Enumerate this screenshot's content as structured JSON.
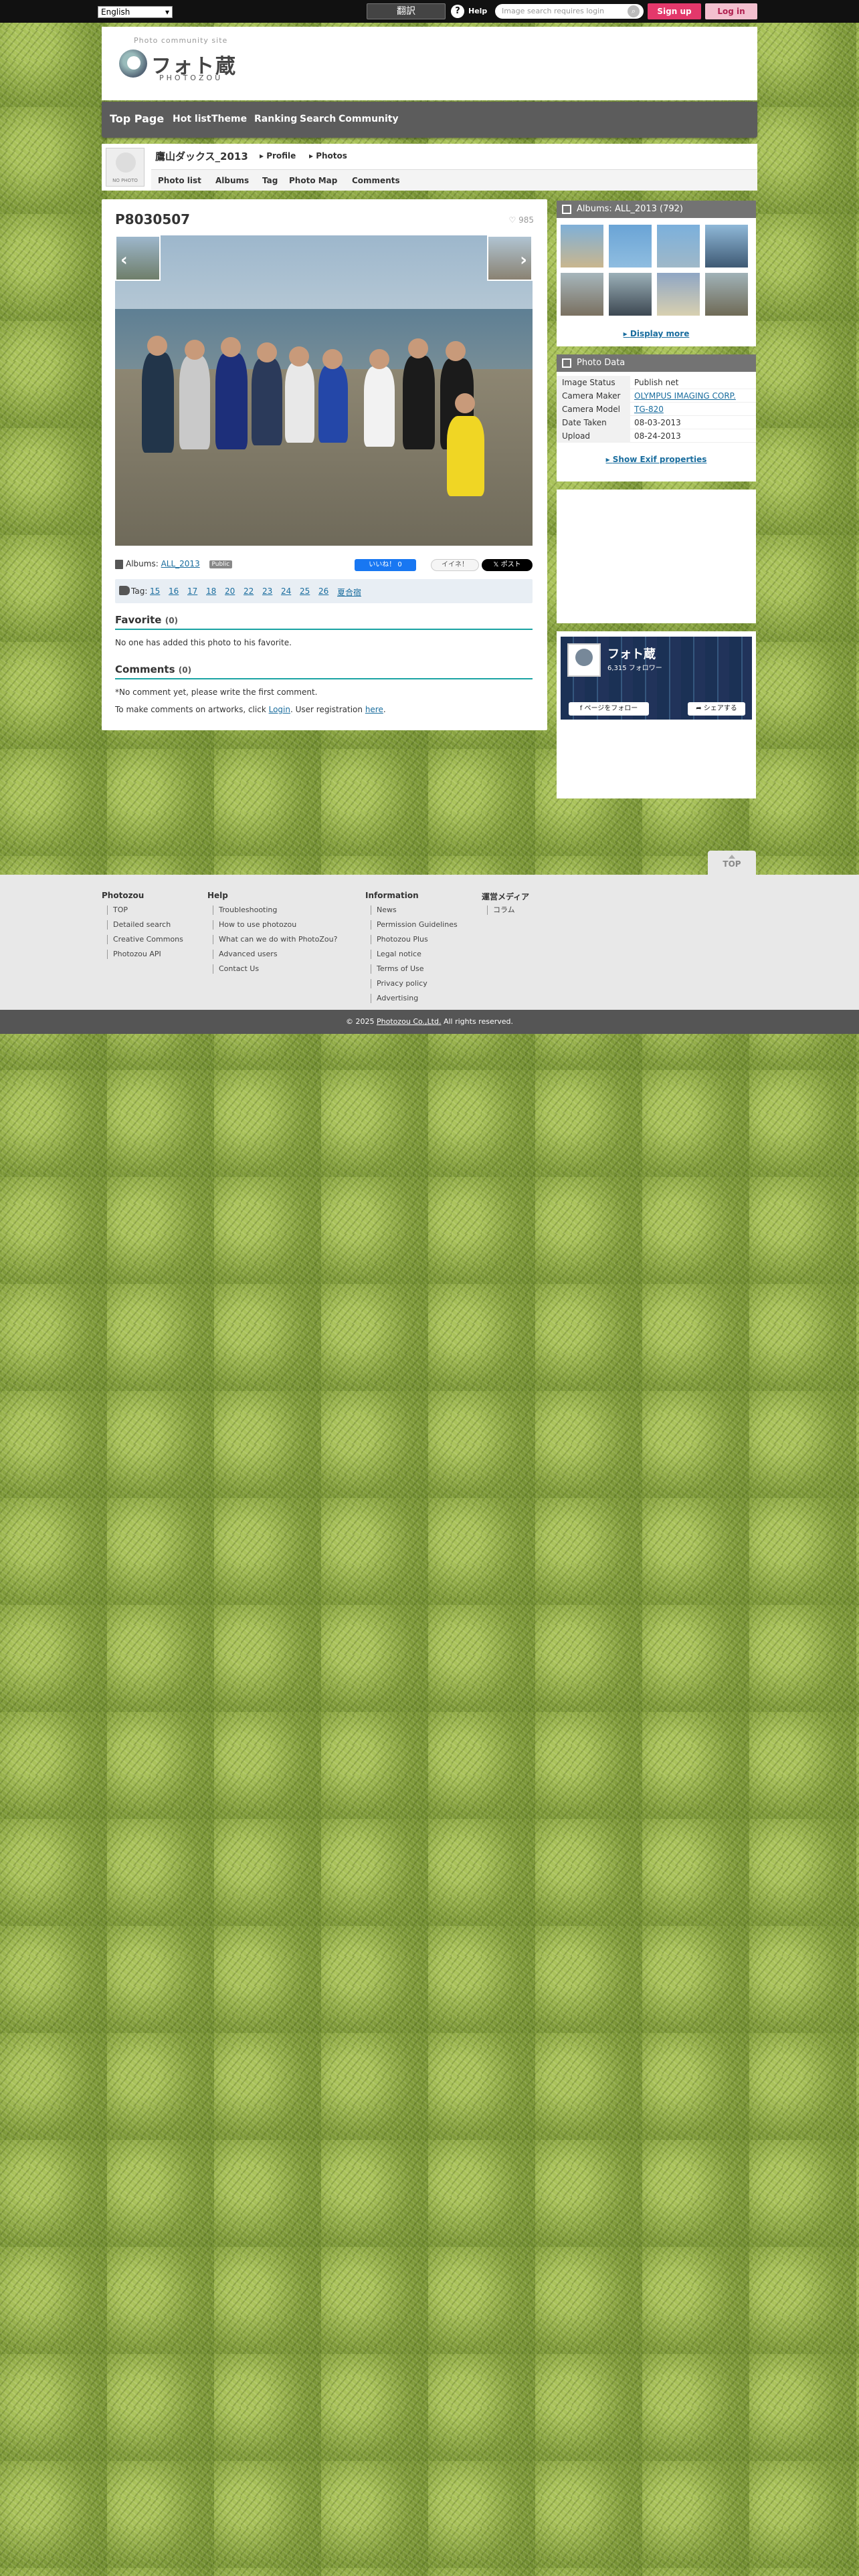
{
  "topbar": {
    "language": "English",
    "translate_label": "翻訳",
    "help_label": "Help",
    "search_placeholder": "Image search requires login",
    "signup_label": "Sign up",
    "login_label": "Log in"
  },
  "header": {
    "tagline": "Photo community site",
    "logo_text": "フォト蔵",
    "logo_sub": "PHOTOZOU"
  },
  "nav": {
    "items": [
      "Top Page",
      "Hot list",
      "Theme",
      "Ranking",
      "Search",
      "Community"
    ]
  },
  "profile": {
    "no_photo": "NO PHOTO",
    "username": "鷹山ダックス_2013",
    "profile_link": "Profile",
    "photos_link": "Photos",
    "subnav": [
      "Photo list",
      "Albums",
      "Tag",
      "Photo Map",
      "Comments"
    ]
  },
  "photo": {
    "title": "P8030507",
    "like_count": "985",
    "albums_label": "Albums:",
    "album_name": "ALL_2013",
    "public_badge": "Public",
    "fb_like": "いいね！ 0",
    "ii_label": "イイネ！",
    "x_post": "ポスト",
    "tags_label": "Tag:",
    "tags": [
      "15",
      "16",
      "17",
      "18",
      "20",
      "22",
      "23",
      "24",
      "25",
      "26",
      "夏合宿"
    ]
  },
  "favorite": {
    "title": "Favorite",
    "count": "(0)",
    "empty_text": "No one has added this photo to his favorite."
  },
  "comments": {
    "title": "Comments",
    "count": "(0)",
    "empty_text": "*No comment yet, please write the first comment.",
    "login_prefix": "To make comments on artworks, click ",
    "login_link": "Login",
    "login_mid": ". User registration ",
    "here_link": "here",
    "login_suffix": "."
  },
  "sidebar": {
    "albums_title": "Albums: ALL_2013 (792)",
    "display_more": "Display more",
    "photo_data_title": "Photo Data",
    "photo_data": [
      {
        "key": "Image Status",
        "value": "Publish net",
        "link": false
      },
      {
        "key": "Camera Maker",
        "value": "OLYMPUS IMAGING CORP.",
        "link": true
      },
      {
        "key": "Camera Model",
        "value": "TG-820",
        "link": true
      },
      {
        "key": "Date Taken",
        "value": "08-03-2013",
        "link": false
      },
      {
        "key": "Upload",
        "value": "08-24-2013",
        "link": false
      }
    ],
    "show_exif": "Show Exif properties",
    "fb_name": "フォト蔵",
    "fb_followers": "6,315 フォロワー",
    "fb_follow": "ページをフォロー",
    "fb_share": "シェアする"
  },
  "footer": {
    "top_label": "TOP",
    "columns": [
      {
        "title": "Photozou",
        "links": [
          "TOP",
          "Detailed search",
          "Creative Commons",
          "Photozou API"
        ]
      },
      {
        "title": "Help",
        "links": [
          "Troubleshooting",
          "How to use photozou",
          "What can we do with PhotoZou?",
          "Advanced users",
          "Contact Us"
        ]
      },
      {
        "title": "Information",
        "links": [
          "News",
          "Permission Guidelines",
          "Photozou Plus",
          "Legal notice",
          "Terms of Use",
          "Privacy policy",
          "Advertising"
        ]
      },
      {
        "title": "運営メディア",
        "links": [
          "コラム"
        ]
      }
    ],
    "copyright_prefix": "© 2025 ",
    "copyright_company": "Photozou Co.,Ltd.",
    "copyright_suffix": " All rights reserved."
  },
  "colors": {
    "accent_teal": "#1aa3a3",
    "signup_pink": "#e3386b",
    "nav_gray": "#5c5c5c",
    "link_blue": "#1a6d9e"
  }
}
